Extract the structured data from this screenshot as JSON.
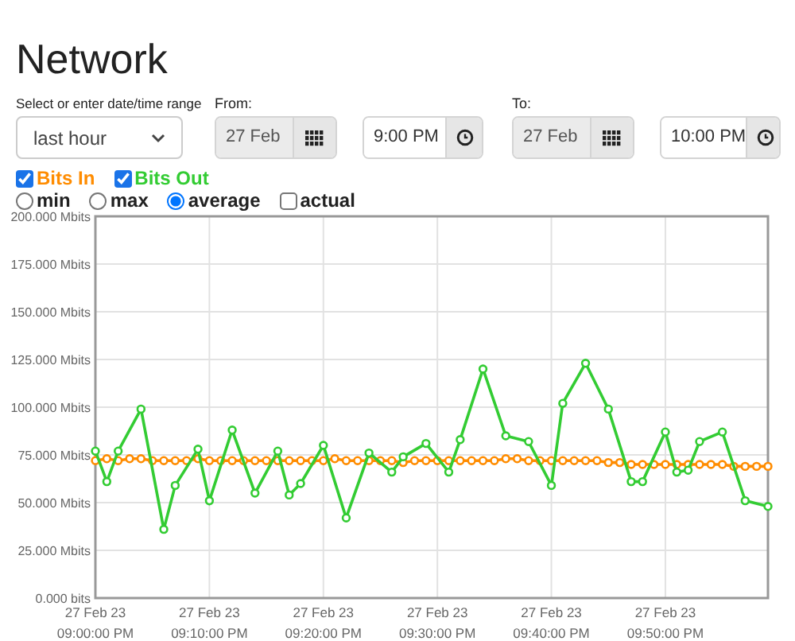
{
  "title": "Network",
  "range": {
    "label": "Select or enter date/time range",
    "value": "last hour"
  },
  "from": {
    "label": "From:",
    "date": "27 Feb",
    "time": "9:00 PM"
  },
  "to": {
    "label": "To:",
    "date": "27 Feb",
    "time": "10:00 PM"
  },
  "series_toggles": [
    {
      "checked": true
    },
    {
      "checked": true
    }
  ],
  "modes": [
    {
      "kind": "radio",
      "label": "min",
      "selected": false
    },
    {
      "kind": "radio",
      "label": "max",
      "selected": false
    },
    {
      "kind": "radio",
      "label": "average",
      "selected": true
    },
    {
      "kind": "checkbox",
      "label": "actual",
      "selected": false
    }
  ],
  "chart": {
    "chart_data": {
      "type": "line",
      "categories": [
        "27 Feb 23\n09:00:00 PM",
        null,
        null,
        null,
        null,
        null,
        null,
        null,
        null,
        null,
        "27 Feb 23\n09:10:00 PM",
        null,
        null,
        null,
        null,
        null,
        null,
        null,
        null,
        null,
        "27 Feb 23\n09:20:00 PM",
        null,
        null,
        null,
        null,
        null,
        null,
        null,
        null,
        null,
        "27 Feb 23\n09:30:00 PM",
        null,
        null,
        null,
        null,
        null,
        null,
        null,
        null,
        null,
        "27 Feb 23\n09:40:00 PM",
        null,
        null,
        null,
        null,
        null,
        null,
        null,
        null,
        null,
        "27 Feb 23\n09:50:00 PM",
        null,
        null,
        null,
        null,
        null,
        null,
        null,
        null,
        null
      ],
      "ylim": [
        0,
        200
      ],
      "grid": true,
      "yticks": [
        {
          "value": 0,
          "label": "0.000 bits"
        },
        {
          "value": 25,
          "label": "25.000 Mbits"
        },
        {
          "value": 50,
          "label": "50.000 Mbits"
        },
        {
          "value": 75,
          "label": "75.000 Mbits"
        },
        {
          "value": 100,
          "label": "100.000 Mbits"
        },
        {
          "value": 125,
          "label": "125.000 Mbits"
        },
        {
          "value": 150,
          "label": "150.000 Mbits"
        },
        {
          "value": 175,
          "label": "175.000 Mbits"
        },
        {
          "value": 200,
          "label": "200.000 Mbits"
        }
      ],
      "series": [
        {
          "name": "Bits In",
          "color": "#ff8c00",
          "marker": "circle",
          "values": [
            72,
            73,
            72,
            73,
            73,
            72,
            72,
            72,
            72,
            73,
            72,
            72,
            72,
            72,
            72,
            72,
            72,
            72,
            72,
            72,
            72,
            73,
            72,
            72,
            72,
            72,
            72,
            71,
            72,
            72,
            72,
            72,
            72,
            72,
            72,
            72,
            73,
            73,
            72,
            72,
            72,
            72,
            72,
            72,
            72,
            71,
            71,
            70,
            70,
            70,
            70,
            70,
            70,
            70,
            70,
            70,
            69,
            69,
            69,
            69
          ]
        },
        {
          "name": "Bits Out",
          "color": "#33cc33",
          "marker": "circle",
          "values": [
            77,
            61,
            77,
            null,
            99,
            null,
            36,
            59,
            null,
            78,
            51,
            null,
            88,
            null,
            55,
            null,
            77,
            54,
            60,
            null,
            80,
            null,
            42,
            null,
            76,
            null,
            66,
            74,
            null,
            81,
            null,
            66,
            83,
            null,
            120,
            null,
            85,
            null,
            82,
            null,
            59,
            102,
            null,
            123,
            null,
            99,
            null,
            61,
            61,
            null,
            87,
            66,
            67,
            82,
            null,
            87,
            null,
            51,
            null,
            48
          ]
        }
      ]
    }
  }
}
